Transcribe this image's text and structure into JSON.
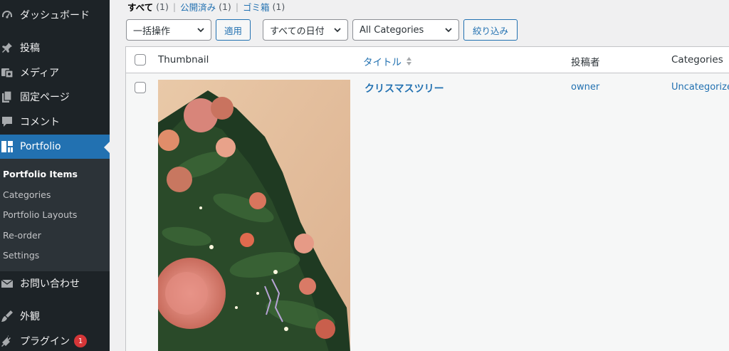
{
  "sidebar": {
    "items": [
      {
        "label": "ダッシュボード",
        "icon": "dashboard-icon"
      },
      {
        "label": "投稿",
        "icon": "pin-icon"
      },
      {
        "label": "メディア",
        "icon": "media-icon"
      },
      {
        "label": "固定ページ",
        "icon": "page-icon"
      },
      {
        "label": "コメント",
        "icon": "comment-icon"
      },
      {
        "label": "Portfolio",
        "icon": "portfolio-icon"
      },
      {
        "label": "お問い合わせ",
        "icon": "mail-icon"
      },
      {
        "label": "外観",
        "icon": "brush-icon"
      },
      {
        "label": "プラグイン",
        "icon": "plugin-icon",
        "badge": "1"
      }
    ],
    "submenu": [
      {
        "label": "Portfolio Items"
      },
      {
        "label": "Categories"
      },
      {
        "label": "Portfolio Layouts"
      },
      {
        "label": "Re-order"
      },
      {
        "label": "Settings"
      }
    ]
  },
  "filters": {
    "all": {
      "label": "すべて",
      "count": "(1)"
    },
    "published": {
      "label": "公開済み",
      "count": "(1)"
    },
    "trash": {
      "label": "ゴミ箱",
      "count": "(1)"
    },
    "separator": "|"
  },
  "toolbar": {
    "bulk_action": "一括操作",
    "apply_label": "適用",
    "date_filter": "すべての日付",
    "category_filter": "All Categories",
    "filter_label": "絞り込み"
  },
  "table": {
    "headers": {
      "thumbnail": "Thumbnail",
      "title": "タイトル",
      "author": "投稿者",
      "categories": "Categories"
    },
    "rows": [
      {
        "title": "クリスマスツリー",
        "author": "owner",
        "categories": "Uncategorized"
      }
    ]
  },
  "colors": {
    "accent": "#2271b1",
    "sidebar_bg": "#1d2327",
    "badge": "#d63638"
  }
}
